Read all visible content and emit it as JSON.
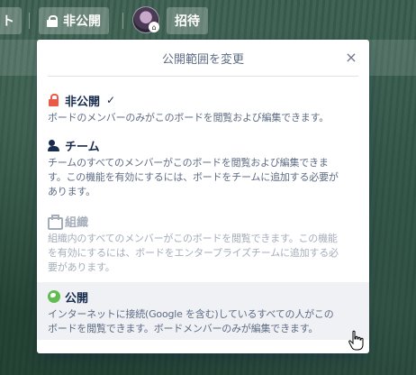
{
  "topbar": {
    "left_button_fragment": "ト",
    "privacy_button_label": "非公開",
    "invite_button_label": "招待",
    "avatar_badge_glyph": "⌂"
  },
  "popover": {
    "title": "公開範囲を変更",
    "close_glyph": "×",
    "options": [
      {
        "icon": "lock-icon",
        "title": "非公開",
        "selected": true,
        "check_glyph": "✓",
        "description": "ボードのメンバーのみがこのボードを閲覧および編集できます。",
        "disabled": false
      },
      {
        "icon": "team-icon",
        "title": "チーム",
        "selected": false,
        "description_lines": [
          "チームのすべてのメンバーがこのボードを閲覧および編集できま",
          "す。この機能を有効にするには、ボードをチームに追加する必要が",
          "あります。"
        ],
        "disabled": false
      },
      {
        "icon": "organization-icon",
        "title": "組織",
        "selected": false,
        "description_lines": [
          "組織内のすべてのメンバーがこのボードを閲覧できます。この機能",
          "を有効にするには、ボードをエンタープライズチームに追加する必",
          "要があります。"
        ],
        "disabled": true
      },
      {
        "icon": "globe-icon",
        "title": "公開",
        "selected": false,
        "hovered": true,
        "description_lines": [
          "インターネットに接続(Google を含む)しているすべての人がこの",
          "ボードを閲覧できます。ボードメンバーのみが編集できます。"
        ],
        "disabled": false
      }
    ]
  },
  "colors": {
    "lock_red": "#eb5a46",
    "globe_green": "#61bd4f",
    "text_dark": "#172b4d",
    "text_muted": "#5e6c84",
    "text_disabled": "#a5adba"
  }
}
